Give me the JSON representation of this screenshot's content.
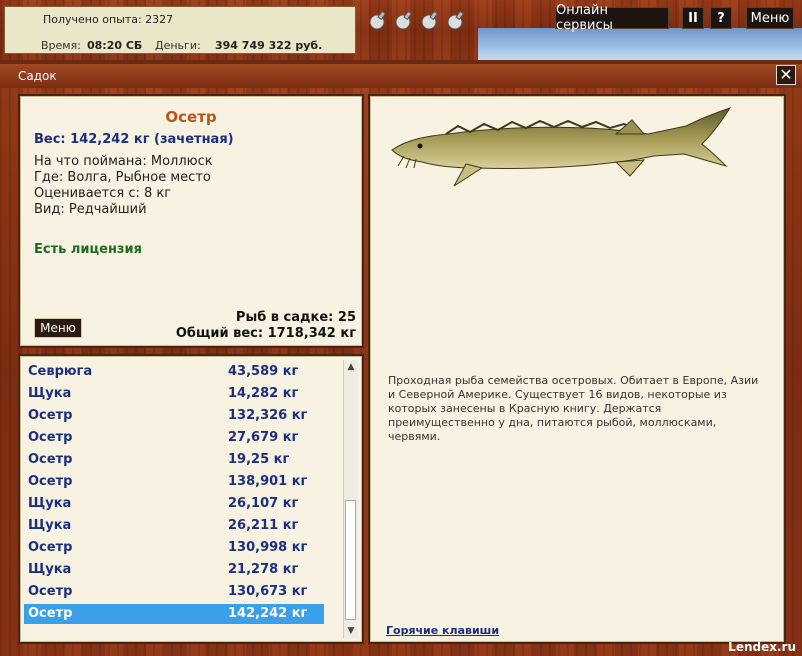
{
  "top": {
    "experience": "Получено опыта: 2327",
    "time_label": "Время:",
    "time_value": "08:20 СБ",
    "money_label": "Деньги:",
    "money_value": "394 749 322 руб.",
    "buttons": {
      "online": "Онлайн сервисы",
      "pause": "II",
      "help": "?",
      "menu": "Меню"
    }
  },
  "window": {
    "title": "Садок",
    "close": "✕"
  },
  "fish": {
    "name": "Осетр",
    "weight": "Вес: 142,242 кг (зачетная)",
    "caught_on": "На что поймана: Моллюск",
    "where": "Где: Волга, Рыбное место",
    "rated_from": "Оценивается с: 8 кг",
    "kind": "Вид: Редчайший",
    "license": "Есть лицензия",
    "menu_button": "Меню",
    "fish_count": "Рыб в садке: 25",
    "total_weight": "Общий вес: 1718,342 кг"
  },
  "list": [
    {
      "name": "Севрюга",
      "weight": "43,589 кг"
    },
    {
      "name": "Щука",
      "weight": "14,282 кг"
    },
    {
      "name": "Осетр",
      "weight": "132,326 кг"
    },
    {
      "name": "Осетр",
      "weight": "27,679 кг"
    },
    {
      "name": "Осетр",
      "weight": "19,25 кг"
    },
    {
      "name": "Осетр",
      "weight": "138,901 кг"
    },
    {
      "name": "Щука",
      "weight": "26,107 кг"
    },
    {
      "name": "Щука",
      "weight": "26,211 кг"
    },
    {
      "name": "Осетр",
      "weight": "130,998 кг"
    },
    {
      "name": "Щука",
      "weight": "21,278 кг"
    },
    {
      "name": "Осетр",
      "weight": "130,673 кг"
    },
    {
      "name": "Осетр",
      "weight": "142,242 кг"
    }
  ],
  "selected_index": 11,
  "description": {
    "text": "Проходная рыба семейства осетровых. Обитает в  Европе, Азии и Северной Америке. Существует 16 видов, некоторые из которых  занесены в Красную книгу. Держатся преимущественно у дна, питаются рыбой, моллюсками, червями.",
    "hotkeys": "Горячие клавиши"
  },
  "watermark": "Lendex.ru",
  "colors": {
    "fish_name": "#b5561a",
    "list_text": "#1b2f7f",
    "selected_row": "#3aa0ea",
    "license": "#1f6b1f"
  }
}
